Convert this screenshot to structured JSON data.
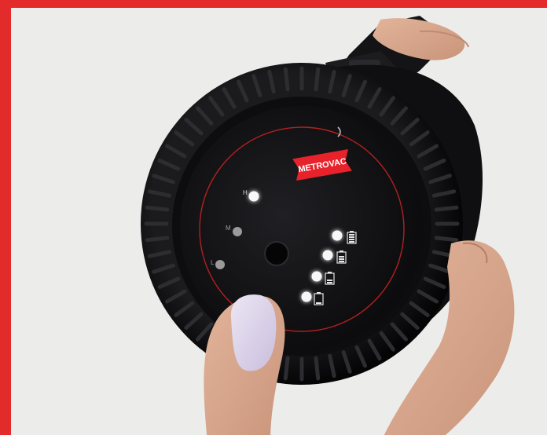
{
  "brand": {
    "logo_text": "METROVAC",
    "logo_color": "#e8222a",
    "frame_color": "#e42b2b"
  },
  "speed_indicators": [
    {
      "label": "H",
      "state": "on"
    },
    {
      "label": "M",
      "state": "off"
    },
    {
      "label": "L",
      "state": "off"
    }
  ],
  "battery_indicators": [
    {
      "level": 4,
      "state": "on"
    },
    {
      "level": 3,
      "state": "on"
    },
    {
      "level": 2,
      "state": "on"
    },
    {
      "level": 1,
      "state": "on"
    }
  ],
  "colors": {
    "background": "#ececeb",
    "body_black": "#111113",
    "led_on": "#f7f7f7",
    "led_off": "#9a9a9a",
    "accent_ring": "#b3211f"
  }
}
